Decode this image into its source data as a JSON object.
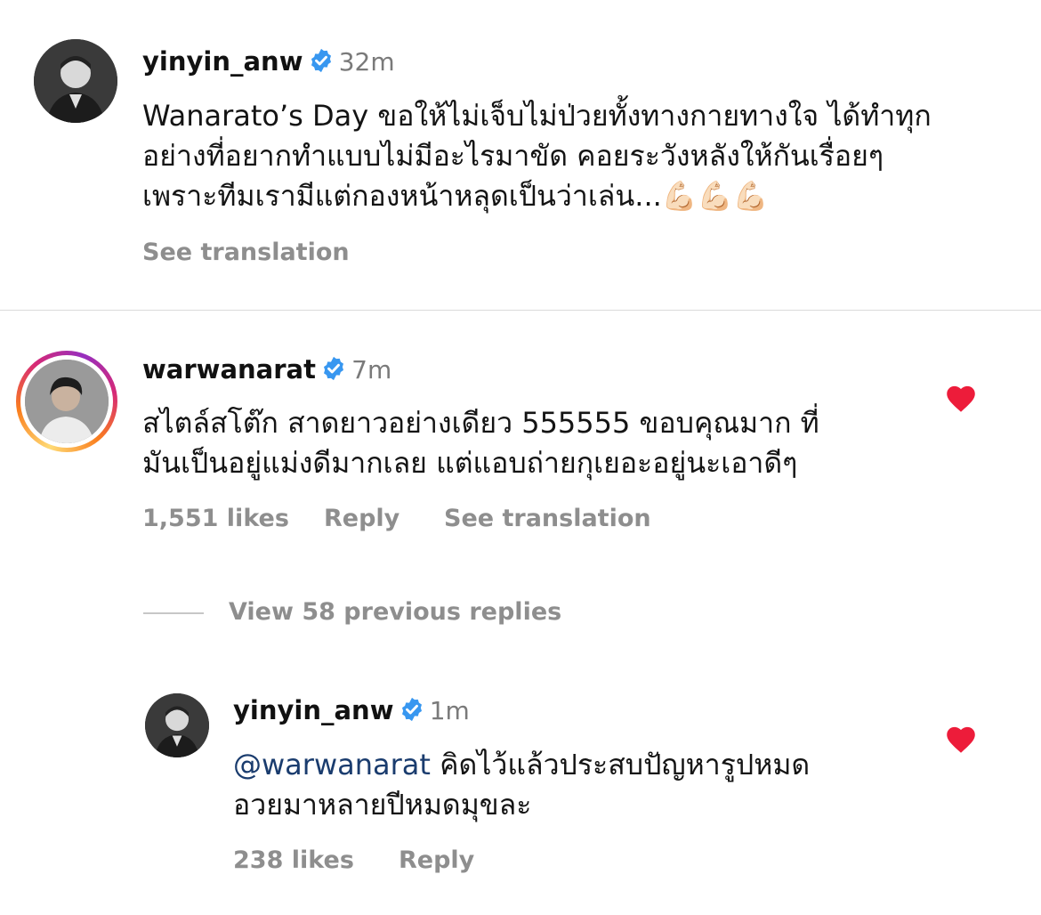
{
  "caption": {
    "username": "yinyin_anw",
    "time": "32m",
    "text_lines": [
      "Wanarato’s Day ขอให้ไม่เจ็บไม่ป่วยทั้งทางกายทางใจ ได้ทำทุก",
      "อย่างที่อยากทำแบบไม่มีอะไรมาขัด คอยระวังหลังให้กันเรื่อยๆ",
      "เพราะทีมเรามีแต่กองหน้าหลุดเป็นว่าเล่น..."
    ],
    "emoji": "💪🏻💪🏻💪🏻",
    "see_translation": "See translation"
  },
  "comment": {
    "username": "warwanarat",
    "time": "7m",
    "text_lines": [
      "สไตล์สโต๊ก สาดยาวอย่างเดียว 555555 ขอบคุณมาก ที่",
      "มันเป็นอยู่แม่งดีมากเลย แต่แอบถ่ายกุเยอะอยู่นะเอาดีๆ"
    ],
    "likes": "1,551 likes",
    "reply": "Reply",
    "see_translation": "See translation",
    "liked": true
  },
  "view_replies": "View 58 previous replies",
  "reply": {
    "username": "yinyin_anw",
    "time": "1m",
    "mention": "@warwanarat",
    "text_line1_rest": " คิดไว้แล้วประสบปัญหารูปหมด",
    "text_line2": "อวยมาหลายปีหมดมุขละ",
    "likes": "238 likes",
    "reply": "Reply",
    "liked": true
  },
  "colors": {
    "verified": "#3897f0",
    "heart": "#ed1c3a",
    "muted": "#8e8e8e"
  }
}
